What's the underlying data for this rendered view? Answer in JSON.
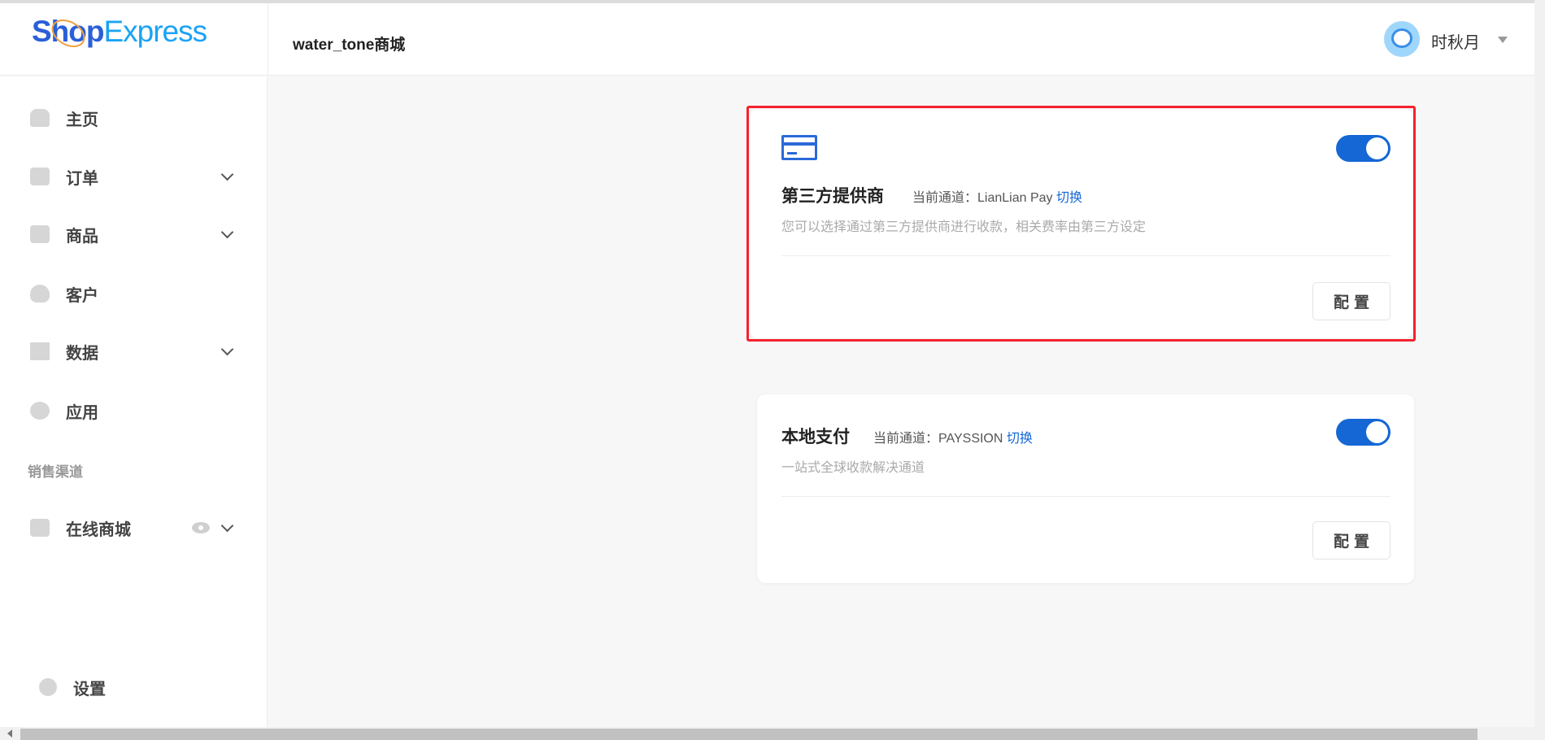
{
  "header": {
    "logo_text_a": "Shop",
    "logo_text_b": "Express",
    "store_name": "water_tone商城",
    "user_name": "时秋月"
  },
  "sidebar": {
    "items": [
      {
        "label": "主页",
        "icon": "home-icon"
      },
      {
        "label": "订单",
        "icon": "order-icon",
        "expandable": true
      },
      {
        "label": "商品",
        "icon": "bag-icon",
        "expandable": true
      },
      {
        "label": "客户",
        "icon": "user-icon"
      },
      {
        "label": "数据",
        "icon": "chart-icon",
        "expandable": true
      },
      {
        "label": "应用",
        "icon": "app-icon"
      }
    ],
    "section_label": "销售渠道",
    "channel": {
      "label": "在线商城",
      "icon": "store-icon"
    },
    "settings": {
      "label": "设置",
      "icon": "gear-icon"
    }
  },
  "cards": [
    {
      "title": "第三方提供商",
      "channel_prefix": "当前通道：LianLian Pay",
      "switch_label": "切换",
      "description": "您可以选择通过第三方提供商进行收款，相关费率由第三方设定",
      "enabled": true,
      "button": "配置"
    },
    {
      "title": "本地支付",
      "channel_prefix": "当前通道：PAYSSION",
      "switch_label": "切换",
      "description": "一站式全球收款解决通道",
      "enabled": true,
      "button": "配置"
    }
  ],
  "colors": {
    "accent": "#1467d4",
    "highlight": "#f5222d"
  }
}
